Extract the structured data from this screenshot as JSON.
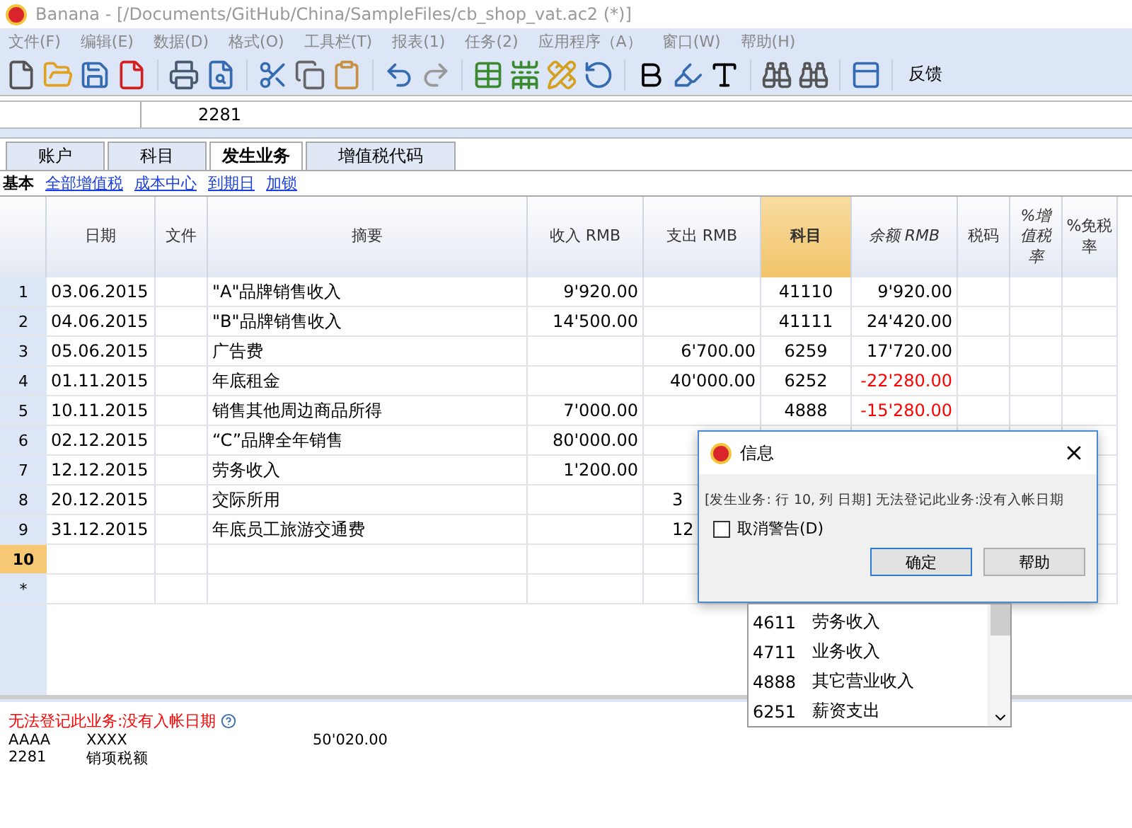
{
  "window": {
    "title": "Banana - [/Documents/GitHub/China/SampleFiles/cb_shop_vat.ac2 (*)]"
  },
  "menu": [
    "文件(F)",
    "编辑(E)",
    "数据(D)",
    "格式(O)",
    "工具栏(T)",
    "报表(1)",
    "任务(2)",
    "应用程序（A）",
    "窗口(W)",
    "帮助(H)"
  ],
  "toolbar": {
    "feedback": "反馈"
  },
  "cell_bar": {
    "value": "2281"
  },
  "tabs": [
    {
      "label": "账户",
      "selected": false
    },
    {
      "label": "科目",
      "selected": false
    },
    {
      "label": "发生业务",
      "selected": true
    },
    {
      "label": "增值税代码",
      "selected": false
    }
  ],
  "views": [
    {
      "label": "基本",
      "selected": true
    },
    {
      "label": "全部增值税",
      "selected": false
    },
    {
      "label": "成本中心",
      "selected": false
    },
    {
      "label": "到期日",
      "selected": false
    },
    {
      "label": "加锁",
      "selected": false
    }
  ],
  "table": {
    "columns": [
      {
        "label": "日期",
        "selected": false,
        "italic": false
      },
      {
        "label": "文件",
        "selected": false,
        "italic": false
      },
      {
        "label": "摘要",
        "selected": false,
        "italic": false
      },
      {
        "label": "收入 RMB",
        "selected": false,
        "italic": false
      },
      {
        "label": "支出 RMB",
        "selected": false,
        "italic": false
      },
      {
        "label": "科目",
        "selected": true,
        "italic": false
      },
      {
        "label": "余额 RMB",
        "selected": false,
        "italic": true
      },
      {
        "label": "税码",
        "selected": false,
        "italic": false
      },
      {
        "label": "%增值税率",
        "selected": false,
        "italic": true
      },
      {
        "label": "%免税率",
        "selected": false,
        "italic": false
      }
    ],
    "rows": [
      {
        "num": "1",
        "selected": false,
        "date": "03.06.2015",
        "desc": "\"A\"品牌销售收入",
        "income": "9'920.00",
        "account": "41110",
        "balance": "9'920.00",
        "negative": false
      },
      {
        "num": "2",
        "selected": false,
        "date": "04.06.2015",
        "desc": "\"B\"品牌销售收入",
        "income": "14'500.00",
        "account": "41111",
        "balance": "24'420.00",
        "negative": false
      },
      {
        "num": "3",
        "selected": false,
        "date": "05.06.2015",
        "desc": "广告费",
        "expense": "6'700.00",
        "account": "6259",
        "balance": "17'720.00",
        "negative": false
      },
      {
        "num": "4",
        "selected": false,
        "date": "01.11.2015",
        "desc": "年底租金",
        "expense": "40'000.00",
        "account": "6252",
        "balance": "-22'280.00",
        "negative": true
      },
      {
        "num": "5",
        "selected": false,
        "date": "10.11.2015",
        "desc": "销售其他周边商品所得",
        "income": "7'000.00",
        "account": "4888",
        "balance": "-15'280.00",
        "negative": true
      },
      {
        "num": "6",
        "selected": false,
        "date": "02.12.2015",
        "desc": "“C”品牌全年销售",
        "income": "80'000.00"
      },
      {
        "num": "7",
        "selected": false,
        "date": "12.12.2015",
        "desc": "劳务收入",
        "income": "1'200.00"
      },
      {
        "num": "8",
        "selected": false,
        "date": "20.12.2015",
        "desc": "交际所用",
        "expense": "3",
        "cut": true
      },
      {
        "num": "9",
        "selected": false,
        "date": "31.12.2015",
        "desc": "年底员工旅游交通费",
        "expense": "12",
        "cut": true
      },
      {
        "num": "10",
        "selected": true
      },
      {
        "num": "*",
        "selected": false
      }
    ]
  },
  "account_list": [
    {
      "code": "4611",
      "name": "劳务收入"
    },
    {
      "code": "4711",
      "name": "业务收入"
    },
    {
      "code": "4888",
      "name": "其它营业收入"
    },
    {
      "code": "6251",
      "name": "薪资支出"
    }
  ],
  "dialog": {
    "title": "信息",
    "message": "[发生业务: 行 10, 列 日期] 无法登记此业务:没有入帐日期",
    "checkbox": {
      "label": "取消警告(D)",
      "checked": false
    },
    "buttons": [
      {
        "label": "确定",
        "selected": true
      },
      {
        "label": "帮助",
        "selected": false
      }
    ]
  },
  "info_panel": {
    "error": "无法登记此业务:没有入帐日期",
    "lines": [
      {
        "code": "AAAA",
        "name": "XXXX",
        "amount": "50'020.00"
      },
      {
        "code": "2281",
        "name": "销项税额"
      }
    ]
  }
}
